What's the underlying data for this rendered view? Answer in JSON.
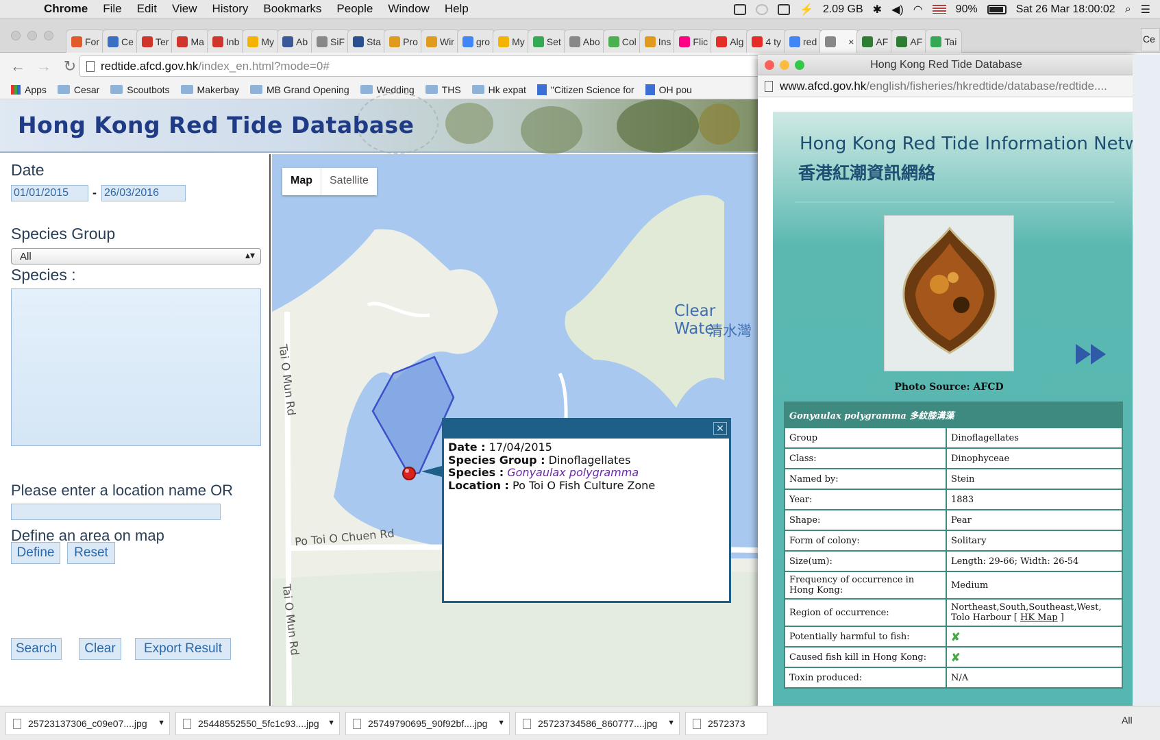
{
  "menubar": {
    "app": "Chrome",
    "items": [
      "File",
      "Edit",
      "View",
      "History",
      "Bookmarks",
      "People",
      "Window",
      "Help"
    ],
    "memory": "2.09 GB",
    "battery": "90%",
    "datetime": "Sat 26 Mar  18:00:02"
  },
  "tabs": [
    {
      "label": "For",
      "color": "#e05a2b"
    },
    {
      "label": "Ce",
      "color": "#3a6fc4"
    },
    {
      "label": "Ter",
      "color": "#d0352b"
    },
    {
      "label": "Ma",
      "color": "#d0352b"
    },
    {
      "label": "Inb",
      "color": "#d0352b"
    },
    {
      "label": "My",
      "color": "#f2b400"
    },
    {
      "label": "Ab",
      "color": "#3b5998"
    },
    {
      "label": "SiF",
      "color": "#888888"
    },
    {
      "label": "Sta",
      "color": "#2a4f8f"
    },
    {
      "label": "Pro",
      "color": "#e09a1e"
    },
    {
      "label": "Wir",
      "color": "#e09a1e"
    },
    {
      "label": "gro",
      "color": "#4285f4"
    },
    {
      "label": "My",
      "color": "#f2b400"
    },
    {
      "label": "Set",
      "color": "#34a853"
    },
    {
      "label": "Abo",
      "color": "#888888"
    },
    {
      "label": "Col",
      "color": "#4caf50"
    },
    {
      "label": "Ins",
      "color": "#e09a1e"
    },
    {
      "label": "Flic",
      "color": "#ff0084"
    },
    {
      "label": "Alg",
      "color": "#e52d27"
    },
    {
      "label": "4 ty",
      "color": "#e52d27"
    },
    {
      "label": "red",
      "color": "#4285f4"
    },
    {
      "label": "",
      "color": "#888888",
      "active": true
    },
    {
      "label": "AF",
      "color": "#2e7d32"
    },
    {
      "label": "AF",
      "color": "#2e7d32"
    },
    {
      "label": "Tai",
      "color": "#34a853"
    }
  ],
  "tab_close": "×",
  "tabstrip_end": "Ce",
  "address": {
    "host": "redtide.afcd.gov.hk",
    "path": "/index_en.html?mode=0#"
  },
  "bookmarks": [
    {
      "label": "Apps",
      "type": "apps"
    },
    {
      "label": "Cesar",
      "type": "folder"
    },
    {
      "label": "Scoutbots",
      "type": "folder"
    },
    {
      "label": "Makerbay",
      "type": "folder"
    },
    {
      "label": "MB Grand Opening",
      "type": "folder"
    },
    {
      "label": "Wedding",
      "type": "folder"
    },
    {
      "label": "THS",
      "type": "folder"
    },
    {
      "label": "Hk expat",
      "type": "folder"
    },
    {
      "label": "\"Citizen Science for",
      "type": "doc"
    },
    {
      "label": "OH pou",
      "type": "doc"
    }
  ],
  "site": {
    "title": "Hong Kong Red Tide Database"
  },
  "search": {
    "date_label": "Date",
    "date_from": "01/01/2015",
    "date_to": "26/03/2016",
    "date_sep": "-",
    "group_label": "Species Group",
    "group_value": "All",
    "species_label": "Species :",
    "location_label": "Please enter a location name OR",
    "location_value": "",
    "area_label": "Define an area on map",
    "define_btn": "Define",
    "reset_btn": "Reset",
    "search_btn": "Search",
    "clear_btn": "Clear",
    "export_btn": "Export Result"
  },
  "map": {
    "type_map": "Map",
    "type_satellite": "Satellite",
    "place_en": "Clear Wate",
    "place_zh": "清水灣",
    "road1": "Tai O Mun Rd",
    "road2": "Po Toi O Chuen Rd",
    "road3": "Tai O Mun Rd"
  },
  "infowindow": {
    "date_k": "Date :",
    "date_v": "17/04/2015",
    "group_k": "Species Group :",
    "group_v": "Dinoflagellates",
    "species_k": "Species :",
    "species_v": "Gonyaulax polygramma",
    "location_k": "Location :",
    "location_v": "Po Toi O Fish Culture Zone"
  },
  "popup": {
    "window_title": "Hong Kong Red Tide Database",
    "url_host": "www.afcd.gov.hk",
    "url_path": "/english/fisheries/hkredtide/database/redtide....",
    "network_en": "Hong Kong Red Tide Information Network",
    "network_zh": "香港紅潮資訊網絡",
    "photo_source": "Photo Source: AFCD",
    "species_header": "Gonyaulax polygramma 多紋膝溝藻",
    "rows": [
      {
        "k": "Group",
        "v": "Dinoflagellates"
      },
      {
        "k": "Class:",
        "v": "Dinophyceae"
      },
      {
        "k": "Named by:",
        "v": "Stein"
      },
      {
        "k": "Year:",
        "v": "1883"
      },
      {
        "k": "Shape:",
        "v": "Pear"
      },
      {
        "k": "Form of colony:",
        "v": "Solitary"
      },
      {
        "k": "Size(um):",
        "v": "Length: 29-66; Width: 26-54"
      },
      {
        "k": "Frequency of occurrence in Hong Kong:",
        "v": "Medium"
      },
      {
        "k": "Region of occurrence:",
        "v": "Northeast,South,Southeast,West, Tolo Harbour [",
        "v_link": "HK Map",
        "v_end": " ]"
      },
      {
        "k": "Potentially harmful to fish:",
        "v": "✘"
      },
      {
        "k": "Caused fish kill in Hong Kong:",
        "v": "✘"
      },
      {
        "k": "Toxin produced:",
        "v": "N/A"
      }
    ]
  },
  "downloads": [
    {
      "name": "25723137306_c09e07....jpg"
    },
    {
      "name": "25448552550_5fc1c93....jpg"
    },
    {
      "name": "25749790695_90f92bf....jpg"
    },
    {
      "name": "25723734586_860777....jpg"
    },
    {
      "name": "2572373"
    }
  ],
  "downloads_show_all": "All",
  "colors": {
    "site_title": "#1f3b86",
    "teal": "#56b6b0",
    "table_border": "#3e8a80",
    "infowindow": "#1d5f86",
    "water": "#a8c8ef",
    "land": "#eef0e8",
    "marker": "#d9231f"
  }
}
